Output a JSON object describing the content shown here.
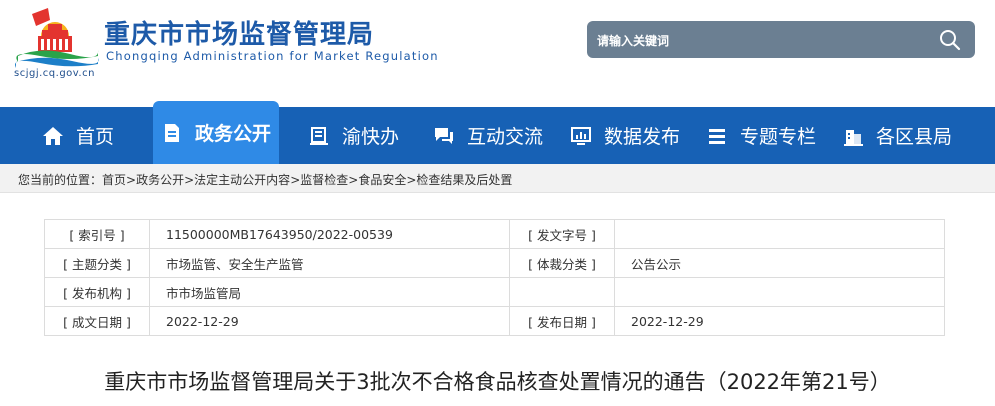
{
  "header": {
    "site_title": "重庆市市场监督管理局",
    "site_subtitle": "Chongqing  Administration for Market Regulation",
    "site_url": "scjgj.cq.gov.cn",
    "search_placeholder": "请输入关键词",
    "search_icon": "search-icon"
  },
  "nav": {
    "items": [
      {
        "label": "首页",
        "icon": "home-icon"
      },
      {
        "label": "政务公开",
        "icon": "document-icon",
        "active": true
      },
      {
        "label": "渝快办",
        "icon": "book-icon"
      },
      {
        "label": "互动交流",
        "icon": "chat-icon"
      },
      {
        "label": "数据发布",
        "icon": "monitor-chart-icon"
      },
      {
        "label": "专题专栏",
        "icon": "list-icon"
      },
      {
        "label": "各区县局",
        "icon": "building-icon"
      }
    ]
  },
  "breadcrumb": {
    "prefix": "您当前的位置：",
    "items": [
      "首页",
      "政务公开",
      "法定主动公开内容",
      "监督检查",
      "食品安全",
      "检查结果及后处置"
    ],
    "separator": ">"
  },
  "info": {
    "index_label": "[ 索引号 ]",
    "index_value": "11500000MB17643950/2022-00539",
    "doc_no_label": "[ 发文字号 ]",
    "doc_no_value": "",
    "topic_label": "[ 主题分类 ]",
    "topic_value": "市场监管、安全生产监管",
    "genre_label": "[ 体裁分类 ]",
    "genre_value": "公告公示",
    "issuer_label": "[ 发布机构 ]",
    "issuer_value": "市市场监管局",
    "created_label": "[ 成文日期 ]",
    "created_value": "2022-12-29",
    "published_label": "[ 发布日期 ]",
    "published_value": "2022-12-29"
  },
  "document": {
    "title": "重庆市市场监督管理局关于3批次不合格食品核查处置情况的通告（2022年第21号）"
  },
  "colors": {
    "nav_bg": "#1761b5",
    "nav_active": "#2f8ae6",
    "title_blue": "#1d5aa8",
    "search_bg": "#6b7f92"
  }
}
